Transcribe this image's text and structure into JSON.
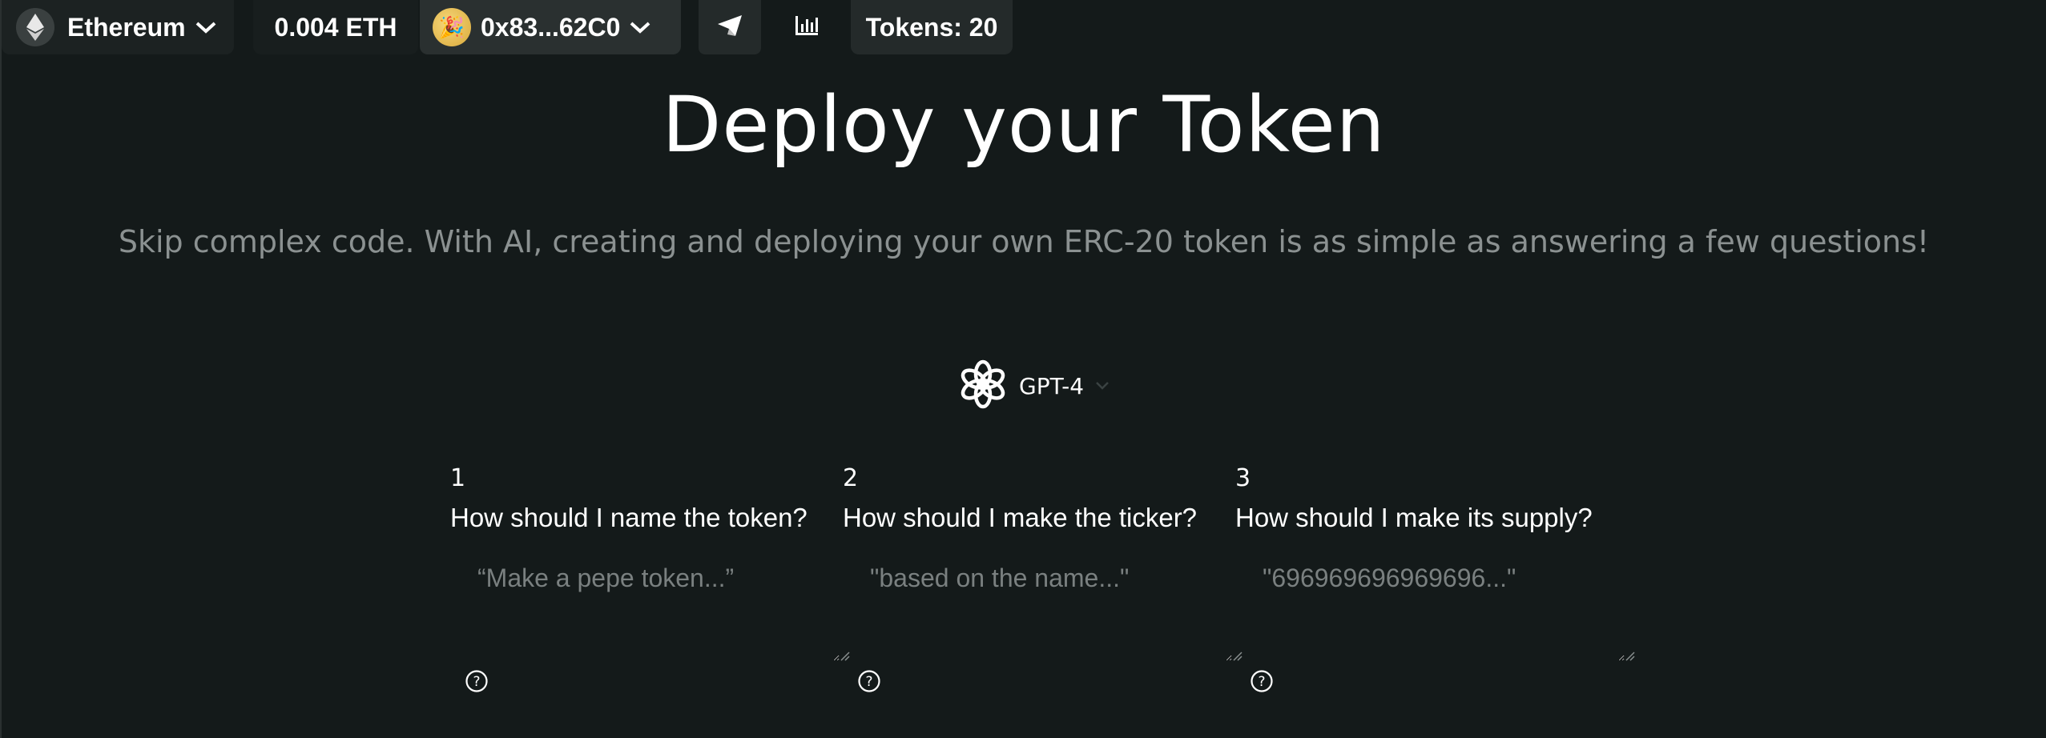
{
  "topbar": {
    "network_label": "Ethereum",
    "balance": "0.004 ETH",
    "wallet_address": "0x83...62C0",
    "wallet_avatar": "🎉",
    "tokens_label": "Tokens: 20"
  },
  "hero": {
    "title": "Deploy your Token",
    "subtitle": "Skip complex code. With AI, creating and deploying your own ERC-20 token is as simple as answering a few questions!"
  },
  "model": {
    "label": "GPT-4"
  },
  "questions": [
    {
      "number": "1",
      "text": "How should I name the token?",
      "placeholder": "“Make a pepe token...”"
    },
    {
      "number": "2",
      "text": "How should I make the ticker?",
      "placeholder": "\"based on the name...\""
    },
    {
      "number": "3",
      "text": "How should I make its supply?",
      "placeholder": "\"696969696969696...\""
    }
  ],
  "colors": {
    "background": "#141a1a",
    "pill": "#1c2222",
    "wallet_pill": "#2a3030",
    "muted_text": "#8b9191"
  }
}
